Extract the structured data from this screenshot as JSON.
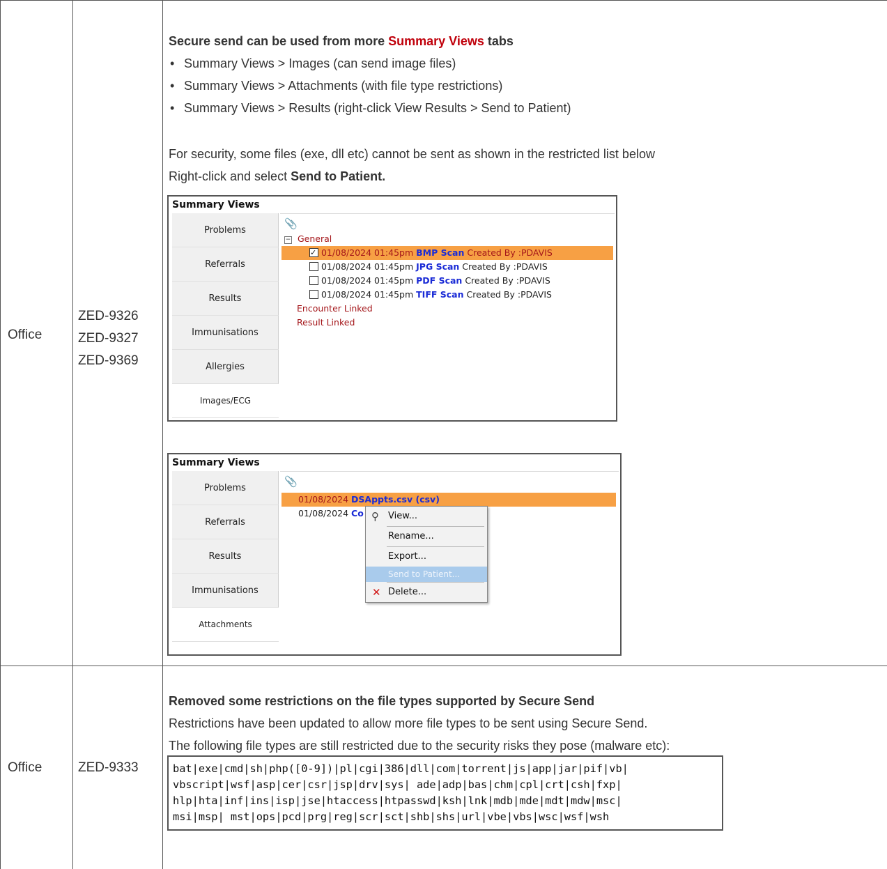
{
  "rows": [
    {
      "area": "Office",
      "ids": [
        "ZED-9326",
        "ZED-9327",
        "ZED-9369"
      ],
      "heading_prefix": "Secure send can be used from more ",
      "heading_link": "Summary Views",
      "heading_suffix": " tabs",
      "bullets": [
        "Summary Views > Images (can send image files)",
        "Summary Views > Attachments (with file type restrictions)",
        "Summary Views > Results (right-click View Results > Send to Patient)"
      ],
      "security_note": "For security, some files (exe, dll etc) cannot be sent as shown in the restricted list below",
      "instruction_prefix": "Right-click and select ",
      "instruction_bold": "Send to Patient."
    },
    {
      "area": "Office",
      "ids": [
        "ZED-9333"
      ],
      "heading": "Removed some restrictions on the file types supported by Secure Send",
      "line1": "Restrictions have been updated to allow more file types to be sent using Secure Send.",
      "line2": "The following file types are still restricted due to the security risks they pose (malware etc):",
      "restricted_list": [
        "bat|exe|cmd|sh|php([0-9])|pl|cgi|386|dll|com|torrent|js|app|jar|pif|vb|",
        "vbscript|wsf|asp|cer|csr|jsp|drv|sys| ade|adp|bas|chm|cpl|crt|csh|fxp|",
        "hlp|hta|inf|ins|isp|jse|htaccess|htpasswd|ksh|lnk|mdb|mde|mdt|mdw|msc|",
        "msi|msp| mst|ops|pcd|prg|reg|scr|sct|shb|shs|url|vbe|vbs|wsc|wsf|wsh"
      ]
    }
  ],
  "screenshot1": {
    "title": "Summary Views",
    "tabs": [
      "Problems",
      "Referrals",
      "Results",
      "Immunisations",
      "Allergies",
      "Images/ECG"
    ],
    "group": "General",
    "items": [
      {
        "date": "01/08/2024 01:45pm",
        "name": "BMP Scan",
        "by": "Created By :PDAVIS",
        "checked": true
      },
      {
        "date": "01/08/2024 01:45pm",
        "name": "JPG Scan",
        "by": "Created By :PDAVIS",
        "checked": false
      },
      {
        "date": "01/08/2024 01:45pm",
        "name": "PDF Scan",
        "by": "Created By :PDAVIS",
        "checked": false
      },
      {
        "date": "01/08/2024 01:45pm",
        "name": "TIFF Scan",
        "by": "Created By :PDAVIS",
        "checked": false
      }
    ],
    "extra_groups": [
      "Encounter Linked",
      "Result Linked"
    ]
  },
  "screenshot2": {
    "title": "Summary Views",
    "tabs": [
      "Problems",
      "Referrals",
      "Results",
      "Immunisations",
      "Attachments"
    ],
    "items": [
      {
        "date": "01/08/2024",
        "name": "DSAppts.csv (csv)"
      },
      {
        "date": "01/08/2024",
        "name": "Co"
      }
    ],
    "menu": [
      "View...",
      "Rename...",
      "Export...",
      "Send to Patient...",
      "Delete..."
    ]
  },
  "colors": {
    "accent_red": "#c0000b",
    "selection": "#f7a044",
    "link_blue": "#1a2bd6",
    "menu_highlight": "#a9cbec"
  }
}
